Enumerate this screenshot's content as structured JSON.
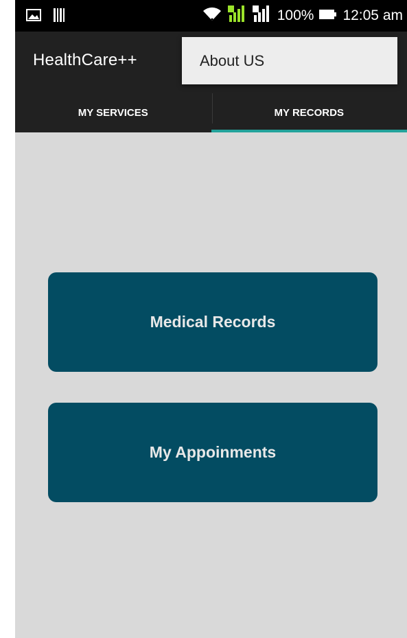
{
  "status_bar": {
    "battery_percent": "100%",
    "time": "12:05 am",
    "icons": [
      "image-icon",
      "barcode-icon",
      "wifi-icon",
      "signal-sim1-icon",
      "signal-sim2-icon",
      "battery-icon"
    ]
  },
  "app_bar": {
    "title": "HealthCare++"
  },
  "overflow_menu": {
    "items": [
      {
        "label": "About US"
      }
    ]
  },
  "tabs": [
    {
      "label": "MY SERVICES",
      "selected": false
    },
    {
      "label": "MY RECORDS",
      "selected": true
    }
  ],
  "main": {
    "buttons": [
      {
        "label": "Medical Records"
      },
      {
        "label": "My Appoinments"
      }
    ]
  },
  "colors": {
    "status_bar": "#000000",
    "app_bar": "#212121",
    "tab_indicator": "#23a39b",
    "content_bg": "#d9d9d9",
    "button_bg": "#034c62",
    "menu_bg": "#ededed"
  }
}
